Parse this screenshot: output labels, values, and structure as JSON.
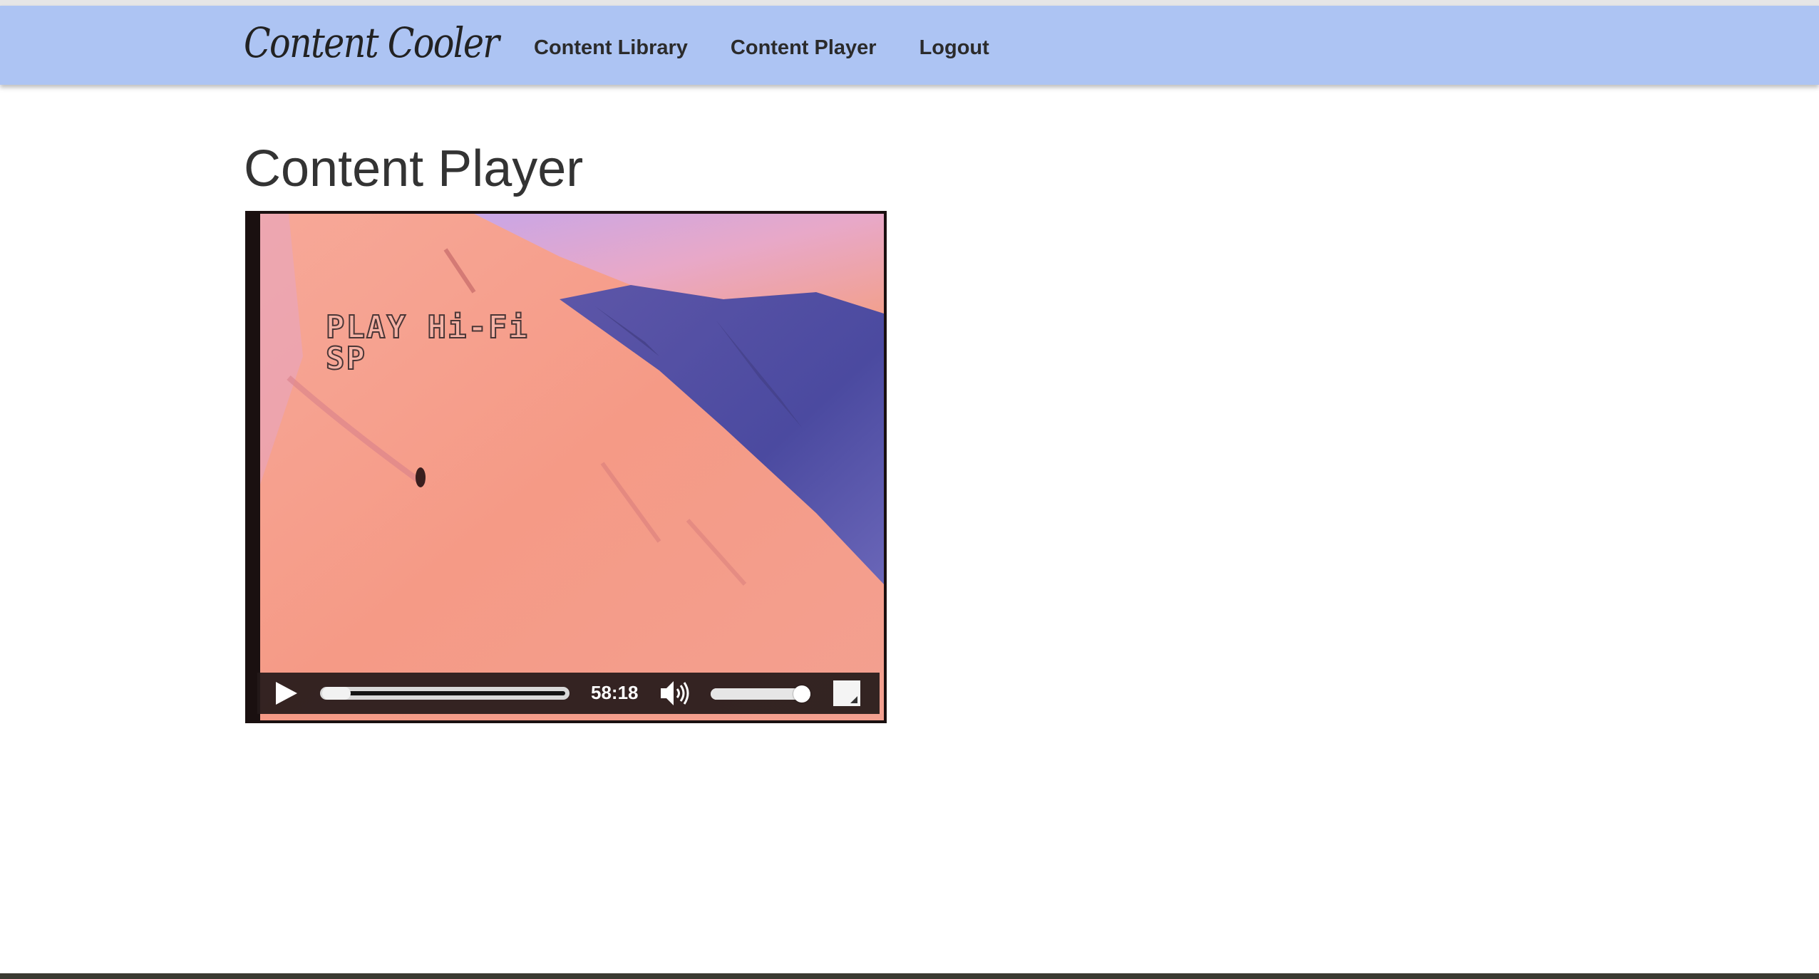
{
  "navbar": {
    "brand": "Content Cooler",
    "links": [
      {
        "label": "Content Library"
      },
      {
        "label": "Content Player"
      },
      {
        "label": "Logout"
      }
    ],
    "background_color": "#adc4f3"
  },
  "main": {
    "title": "Content Player"
  },
  "player": {
    "osd_line1": "PLAY Hi-Fi",
    "osd_line2": "SP",
    "duration": "58:18",
    "progress_fraction": 0.0,
    "volume_fraction": 1.0,
    "icons": {
      "play": "play-icon",
      "volume": "volume-icon",
      "fullscreen": "fullscreen-icon"
    }
  }
}
